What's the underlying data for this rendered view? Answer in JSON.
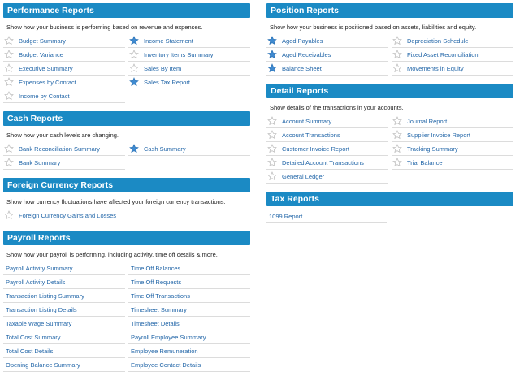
{
  "left": [
    {
      "title": "Performance Reports",
      "description": "Show how your business is performing based on revenue and expenses.",
      "stars": true,
      "columns": [
        [
          {
            "label": "Budget Summary",
            "starred": false
          },
          {
            "label": "Budget Variance",
            "starred": false
          },
          {
            "label": "Executive Summary",
            "starred": false
          },
          {
            "label": "Expenses by Contact",
            "starred": false
          },
          {
            "label": "Income by Contact",
            "starred": false
          }
        ],
        [
          {
            "label": "Income Statement",
            "starred": true
          },
          {
            "label": "Inventory Items Summary",
            "starred": false
          },
          {
            "label": "Sales By Item",
            "starred": false
          },
          {
            "label": "Sales Tax Report",
            "starred": true
          }
        ]
      ]
    },
    {
      "title": "Cash Reports",
      "description": "Show how your cash levels are changing.",
      "stars": true,
      "columns": [
        [
          {
            "label": "Bank Reconciliation Summary",
            "starred": false
          },
          {
            "label": "Bank Summary",
            "starred": false
          }
        ],
        [
          {
            "label": "Cash Summary",
            "starred": true
          }
        ]
      ]
    },
    {
      "title": "Foreign Currency Reports",
      "description": "Show how currency fluctuations have affected your foreign currency transactions.",
      "stars": true,
      "columns": [
        [
          {
            "label": "Foreign Currency Gains and Losses",
            "starred": false
          }
        ]
      ]
    },
    {
      "title": "Payroll Reports",
      "description": "Show how your payroll is performing, including activity, time off details & more.",
      "stars": false,
      "columns": [
        [
          {
            "label": "Payroll Activity Summary"
          },
          {
            "label": "Payroll Activity Details"
          },
          {
            "label": "Transaction Listing Summary"
          },
          {
            "label": "Transaction Listing Details"
          },
          {
            "label": "Taxable Wage Summary"
          },
          {
            "label": "Total Cost Summary"
          },
          {
            "label": "Total Cost Details"
          },
          {
            "label": "Opening Balance Summary"
          }
        ],
        [
          {
            "label": "Time Off Balances"
          },
          {
            "label": "Time Off Requests"
          },
          {
            "label": "Time Off Transactions"
          },
          {
            "label": "Timesheet Summary"
          },
          {
            "label": "Timesheet Details"
          },
          {
            "label": "Payroll Employee Summary"
          },
          {
            "label": "Employee Remuneration"
          },
          {
            "label": "Employee Contact Details"
          }
        ]
      ]
    }
  ],
  "right": [
    {
      "title": "Position Reports",
      "description": "Show how your business is positioned based on assets, liabilities and equity.",
      "stars": true,
      "columns": [
        [
          {
            "label": "Aged Payables",
            "starred": true
          },
          {
            "label": "Aged Receivables",
            "starred": true
          },
          {
            "label": "Balance Sheet",
            "starred": true
          }
        ],
        [
          {
            "label": "Depreciation Schedule",
            "starred": false
          },
          {
            "label": "Fixed Asset Reconciliation",
            "starred": false
          },
          {
            "label": "Movements in Equity",
            "starred": false
          }
        ]
      ]
    },
    {
      "title": "Detail Reports",
      "description": "Show details of the transactions in your accounts.",
      "stars": true,
      "columns": [
        [
          {
            "label": "Account Summary",
            "starred": false
          },
          {
            "label": "Account Transactions",
            "starred": false
          },
          {
            "label": "Customer Invoice Report",
            "starred": false
          },
          {
            "label": "Detailed Account Transactions",
            "starred": false
          },
          {
            "label": "General Ledger",
            "starred": false
          }
        ],
        [
          {
            "label": "Journal Report",
            "starred": false
          },
          {
            "label": "Supplier Invoice Report",
            "starred": false
          },
          {
            "label": "Tracking Summary",
            "starred": false
          },
          {
            "label": "Trial Balance",
            "starred": false
          }
        ]
      ]
    },
    {
      "title": "Tax Reports",
      "description": "",
      "stars": false,
      "columns": [
        [
          {
            "label": "1099 Report"
          }
        ]
      ]
    }
  ],
  "colors": {
    "header": "#1b8ac4",
    "link": "#2266a8",
    "star_filled": "#3f8ad0",
    "star_outline": "#b8b8b8"
  },
  "icons": {
    "starred": "star-filled-icon",
    "unstarred": "star-outline-icon"
  }
}
